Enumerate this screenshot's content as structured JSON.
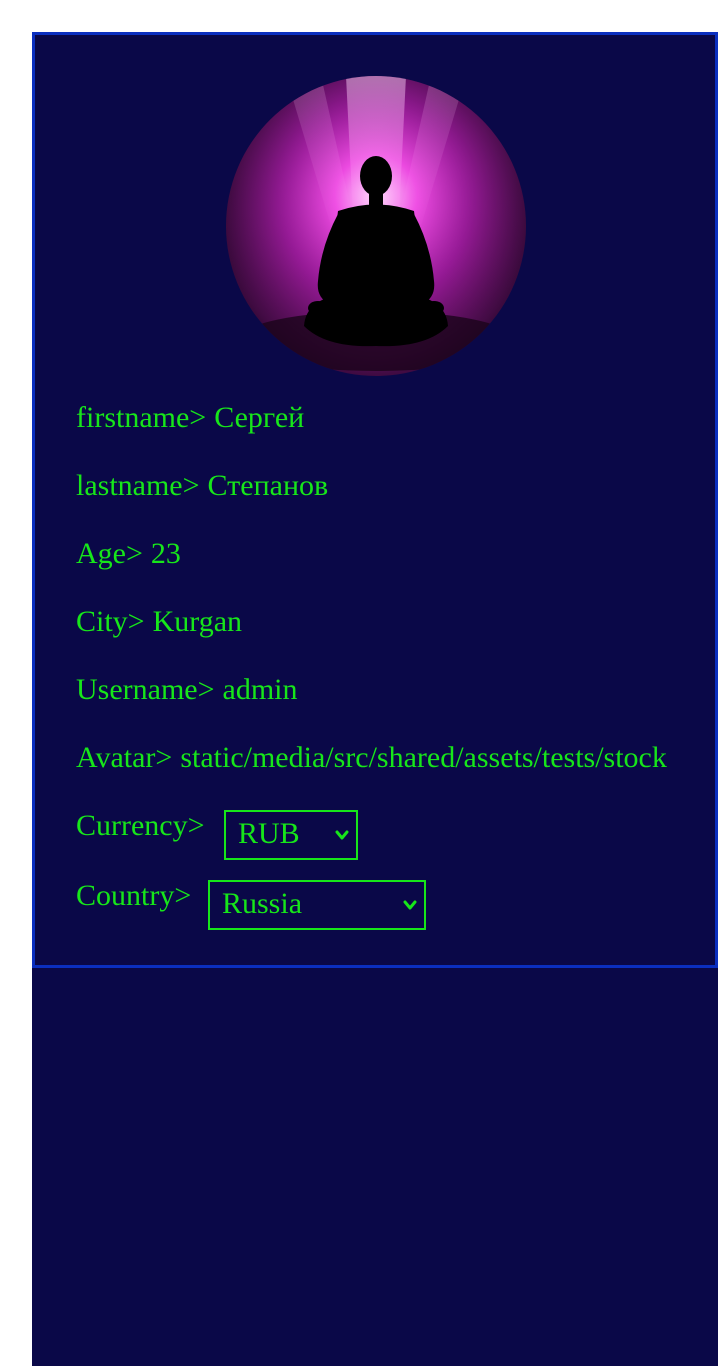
{
  "profile": {
    "avatar_image": "meditating-silhouette-avatar",
    "fields": [
      {
        "label": "firstname>",
        "value": "Сергей"
      },
      {
        "label": "lastname>",
        "value": "Степанов"
      },
      {
        "label": "Age>",
        "value": "23"
      },
      {
        "label": "City>",
        "value": "Kurgan"
      },
      {
        "label": "Username>",
        "value": "admin"
      },
      {
        "label": "Avatar>",
        "value": "static/media/src/shared/assets/tests/stock"
      }
    ],
    "currency": {
      "label": "Currency>",
      "selected": "RUB"
    },
    "country": {
      "label": "Country>",
      "selected": "Russia"
    }
  },
  "colors": {
    "background": "#0a0848",
    "border": "#0b2fbf",
    "text": "#17e61a"
  }
}
